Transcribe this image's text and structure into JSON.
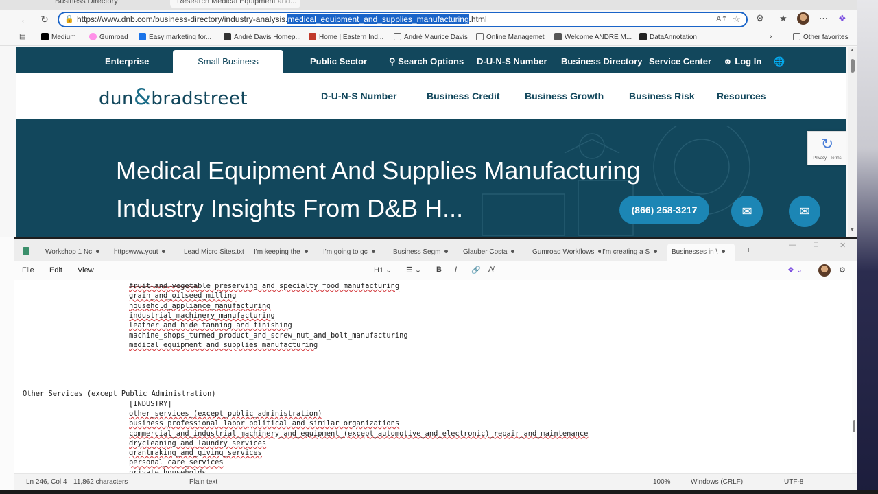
{
  "browser": {
    "tabs": [
      "Business Directory",
      "Research Medical Equipment and..."
    ],
    "url_prefix": "https://www.dnb.com/business-directory/industry-analysis.",
    "url_selected": "medical_equipment_and_supplies_manufacturing",
    "url_suffix": ".html",
    "favorites": [
      {
        "label": "Medium",
        "icon": "medium-icon",
        "color": "#000000"
      },
      {
        "label": "Gumroad",
        "icon": "gumroad-icon",
        "color": "#ff90e8"
      },
      {
        "label": "Easy marketing for...",
        "icon": "arrow-icon",
        "color": "#1a73e8"
      },
      {
        "label": "André Davis Homep...",
        "icon": "home-icon",
        "color": "#333333"
      },
      {
        "label": "Home | Eastern Ind...",
        "icon": "site-icon",
        "color": "#c0392b"
      },
      {
        "label": "André Maurice Davis",
        "icon": "folder-icon",
        "color": "#666666"
      },
      {
        "label": "Online Managemet",
        "icon": "folder-icon",
        "color": "#666666"
      },
      {
        "label": "Welcome ANDRE M...",
        "icon": "site-icon",
        "color": "#555555"
      },
      {
        "label": "DataAnnotation",
        "icon": "site-icon",
        "color": "#222222"
      }
    ],
    "other_favorites": "Other favorites"
  },
  "site": {
    "top_nav": {
      "enterprise": "Enterprise",
      "small_business": "Small Business",
      "public_sector": "Public Sector",
      "search_options": "Search Options",
      "duns": "D-U-N-S Number",
      "business_directory": "Business Directory",
      "service_center": "Service Center",
      "log_in": "Log In"
    },
    "logo": {
      "left": "dun",
      "amp": "&",
      "right": "bradstreet"
    },
    "main_nav": {
      "duns": "D-U-N-S Number",
      "credit": "Business Credit",
      "growth": "Business Growth",
      "risk": "Business Risk",
      "resources": "Resources"
    },
    "hero": {
      "title": "Medical Equipment And Supplies Manufacturing Industry Insights From D&B H...",
      "phone": "(866) 258-3217"
    },
    "recaptcha": "Privacy - Terms"
  },
  "notepad": {
    "tabs": [
      "Workshop 1 Nc",
      "httpswww.yout",
      "Lead Micro Sites.txt",
      "I'm keeping the",
      "I'm going to gc",
      "Business Segm",
      "Glauber Costa",
      "Gumroad Workflows",
      "I'm creating a S",
      "Businesses in \\"
    ],
    "menu": {
      "file": "File",
      "edit": "Edit",
      "view": "View"
    },
    "heading_select": "H1",
    "lines": [
      {
        "text": "fruit_and_vegetable_preserving_and_specialty_food_manufacturing",
        "indent": true,
        "squiggle": true
      },
      {
        "text": "grain_and_oilseed_milling",
        "indent": true,
        "squiggle": true
      },
      {
        "text": "household_appliance_manufacturing",
        "indent": true,
        "squiggle": true
      },
      {
        "text": "industrial_machinery_manufacturing",
        "indent": true,
        "squiggle": true
      },
      {
        "text": "leather_and_hide_tanning_and_finishing",
        "indent": true,
        "squiggle": true
      },
      {
        "text": "machine_shops_turned_product_and_screw_nut_and_bolt_manufacturing",
        "indent": true,
        "squiggle": false
      },
      {
        "text": "medical_equipment_and_supplies_manufacturing",
        "indent": true,
        "squiggle": true
      },
      {
        "text": "",
        "indent": false,
        "squiggle": false
      },
      {
        "text": "",
        "indent": false,
        "squiggle": false
      },
      {
        "text": "",
        "indent": false,
        "squiggle": false
      },
      {
        "text": "",
        "indent": false,
        "squiggle": false
      },
      {
        "text": "Other Services (except Public Administration)",
        "indent": false,
        "squiggle": false
      },
      {
        "text": "[INDUSTRY]",
        "indent": true,
        "squiggle": false
      },
      {
        "text": "other_services_(except_public_administration)",
        "indent": true,
        "squiggle": true
      },
      {
        "text": "business_professional_labor_political_and_similar_organizations",
        "indent": true,
        "squiggle": true
      },
      {
        "text": "commercial_and_industrial_machinery_and_equipment_(except_automotive_and_electronic)_repair_and_maintenance",
        "indent": true,
        "squiggle": true
      },
      {
        "text": "drycleaning_and_laundry_services",
        "indent": true,
        "squiggle": true
      },
      {
        "text": "grantmaking_and_giving_services",
        "indent": true,
        "squiggle": true
      },
      {
        "text": "personal_care_services",
        "indent": true,
        "squiggle": true
      },
      {
        "text": "private_households",
        "indent": true,
        "squiggle": false
      }
    ],
    "status": {
      "position": "Ln 246, Col 4",
      "chars": "11,862 characters",
      "format": "Plain text",
      "zoom": "100%",
      "eol": "Windows (CRLF)",
      "encoding": "UTF-8"
    }
  }
}
